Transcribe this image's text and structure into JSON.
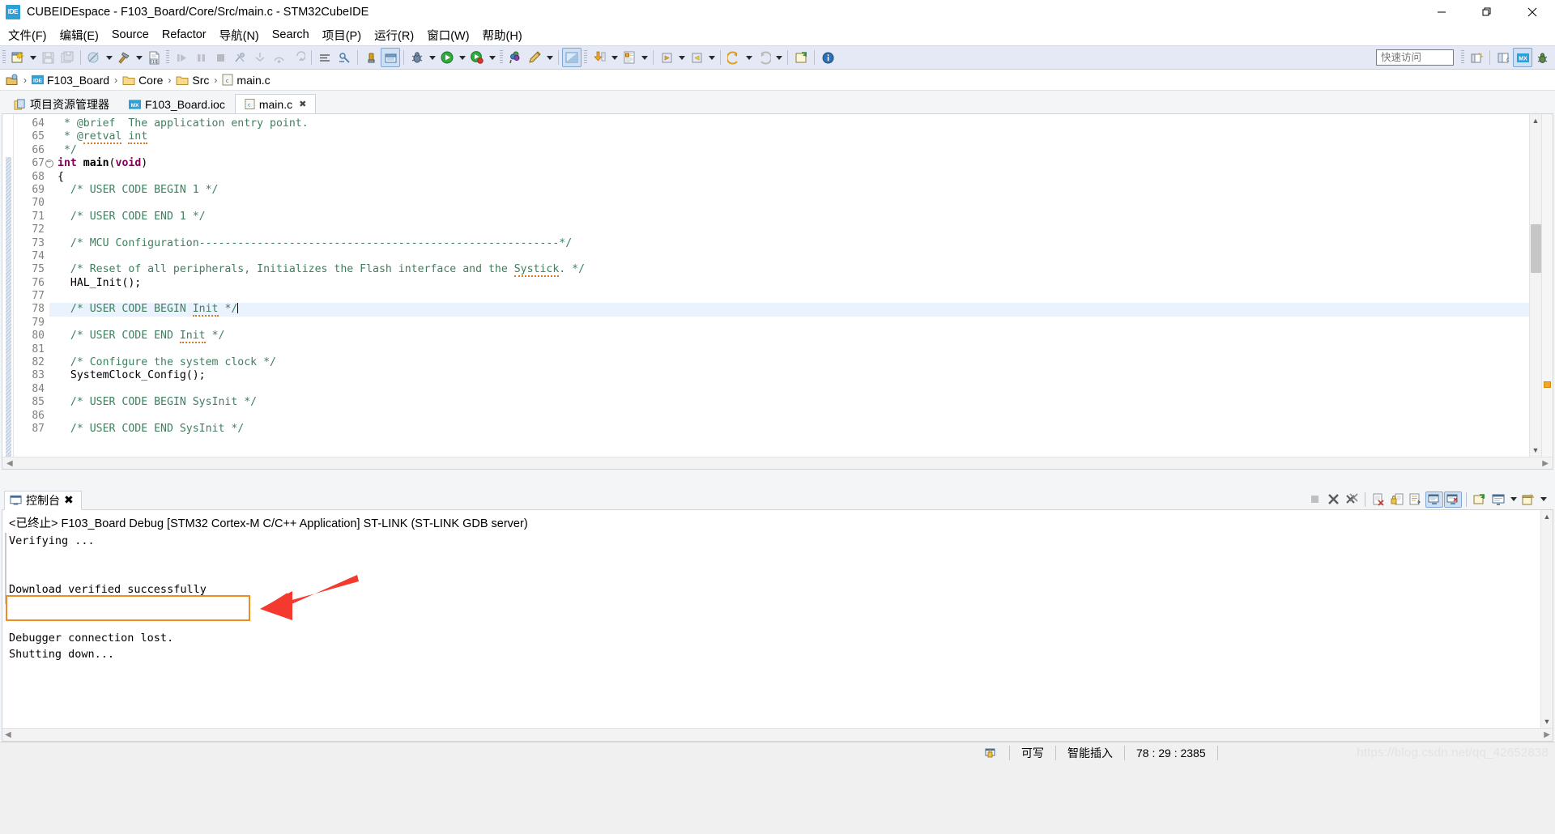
{
  "window": {
    "title": "CUBEIDEspace - F103_Board/Core/Src/main.c - STM32CubeIDE",
    "app_badge": "IDE",
    "minimize": "—",
    "maximize": "❐",
    "close": "✕"
  },
  "menubar": {
    "items": [
      {
        "label": "文件(F)",
        "name": "menu-file"
      },
      {
        "label": "编辑(E)",
        "name": "menu-edit"
      },
      {
        "label": "Source",
        "name": "menu-source"
      },
      {
        "label": "Refactor",
        "name": "menu-refactor"
      },
      {
        "label": "导航(N)",
        "name": "menu-navigate"
      },
      {
        "label": "Search",
        "name": "menu-search"
      },
      {
        "label": "项目(P)",
        "name": "menu-project"
      },
      {
        "label": "运行(R)",
        "name": "menu-run"
      },
      {
        "label": "窗口(W)",
        "name": "menu-window"
      },
      {
        "label": "帮助(H)",
        "name": "menu-help"
      }
    ]
  },
  "toolbar": {
    "quick_access_placeholder": "快速访问",
    "quick_access_value": "",
    "icons": [
      "new-file-icon",
      "save-icon",
      "save-all-icon",
      "build-disabled-icon",
      "build-hammer-icon",
      "new-c-file-icon",
      "resume-icon",
      "suspend-icon",
      "terminate-icon",
      "disconnect-icon",
      "step-into-icon",
      "step-over-icon",
      "step-return-icon",
      "skip-breakpoints-icon",
      "debug-config-icon",
      "run-icon",
      "debug-icon",
      "profile-icon",
      "external-tools-icon",
      "cube-mx-icon",
      "download-icon",
      "open-perspective-icon",
      "search-icon",
      "next-annotation-icon",
      "previous-annotation-icon",
      "last-edit-location-icon",
      "back-icon",
      "forward-icon",
      "pin-editor-icon",
      "info-icon"
    ],
    "right_icons": [
      "new-perspective-icon",
      "c-cpp-perspective-icon",
      "cubemx-perspective-icon",
      "debug-perspective-icon"
    ]
  },
  "breadcrumb": {
    "segments": [
      {
        "label": "",
        "icon": "workspace-icon",
        "name": "breadcrumb-workspace"
      },
      {
        "label": "F103_Board",
        "icon": "project-icon",
        "name": "breadcrumb-project"
      },
      {
        "label": "Core",
        "icon": "folder-icon",
        "name": "breadcrumb-core"
      },
      {
        "label": "Src",
        "icon": "folder-icon",
        "name": "breadcrumb-src"
      },
      {
        "label": "main.c",
        "icon": "c-file-icon",
        "name": "breadcrumb-file"
      }
    ],
    "separator": "›"
  },
  "editor": {
    "tabs": [
      {
        "label": "项目资源管理器",
        "icon": "project-explorer-icon",
        "active": false,
        "closable": false
      },
      {
        "label": "F103_Board.ioc",
        "icon": "cubemx-icon",
        "active": false,
        "closable": false
      },
      {
        "label": "main.c",
        "icon": "c-file-icon",
        "active": true,
        "closable": true
      }
    ],
    "close_glyph": "✖",
    "highlighted_line": 78,
    "lines": [
      {
        "num": 64,
        "fold": false,
        "changed": false,
        "tokens": [
          {
            "t": " * @brief  The application entry point.",
            "c": "comment"
          }
        ]
      },
      {
        "num": 65,
        "fold": false,
        "changed": false,
        "tokens": [
          {
            "t": " * @",
            "c": "comment"
          },
          {
            "t": "retval",
            "c": "comment-spell"
          },
          {
            "t": " ",
            "c": "comment"
          },
          {
            "t": "int",
            "c": "comment-spell"
          }
        ]
      },
      {
        "num": 66,
        "fold": false,
        "changed": false,
        "tokens": [
          {
            "t": " */",
            "c": "comment"
          }
        ]
      },
      {
        "num": 67,
        "fold": true,
        "changed": true,
        "tokens": [
          {
            "t": "int",
            "c": "kw"
          },
          {
            "t": " ",
            "c": "plain"
          },
          {
            "t": "main",
            "c": "bold"
          },
          {
            "t": "(",
            "c": "plain"
          },
          {
            "t": "void",
            "c": "kw"
          },
          {
            "t": ")",
            "c": "plain"
          }
        ]
      },
      {
        "num": 68,
        "fold": false,
        "changed": true,
        "tokens": [
          {
            "t": "{",
            "c": "plain"
          }
        ]
      },
      {
        "num": 69,
        "fold": false,
        "changed": true,
        "tokens": [
          {
            "t": "  /* USER CODE BEGIN 1 */",
            "c": "comment"
          }
        ]
      },
      {
        "num": 70,
        "fold": false,
        "changed": true,
        "tokens": [
          {
            "t": "",
            "c": "plain"
          }
        ]
      },
      {
        "num": 71,
        "fold": false,
        "changed": true,
        "tokens": [
          {
            "t": "  /* USER CODE END 1 */",
            "c": "comment"
          }
        ]
      },
      {
        "num": 72,
        "fold": false,
        "changed": true,
        "tokens": [
          {
            "t": "",
            "c": "plain"
          }
        ]
      },
      {
        "num": 73,
        "fold": false,
        "changed": true,
        "tokens": [
          {
            "t": "  /* MCU Configuration--------------------------------------------------------*/",
            "c": "comment"
          }
        ]
      },
      {
        "num": 74,
        "fold": false,
        "changed": true,
        "tokens": [
          {
            "t": "",
            "c": "plain"
          }
        ]
      },
      {
        "num": 75,
        "fold": false,
        "changed": true,
        "tokens": [
          {
            "t": "  /* Reset of all peripherals, Initializes the Flash interface and the ",
            "c": "comment"
          },
          {
            "t": "Systick",
            "c": "comment-spell"
          },
          {
            "t": ". */",
            "c": "comment"
          }
        ]
      },
      {
        "num": 76,
        "fold": false,
        "changed": true,
        "tokens": [
          {
            "t": "  HAL_Init();",
            "c": "plain"
          }
        ]
      },
      {
        "num": 77,
        "fold": false,
        "changed": true,
        "tokens": [
          {
            "t": "",
            "c": "plain"
          }
        ]
      },
      {
        "num": 78,
        "fold": false,
        "changed": true,
        "tokens": [
          {
            "t": "  /* USER CODE BEGIN ",
            "c": "comment"
          },
          {
            "t": "Init",
            "c": "comment-spell"
          },
          {
            "t": " */",
            "c": "comment"
          }
        ]
      },
      {
        "num": 79,
        "fold": false,
        "changed": true,
        "tokens": [
          {
            "t": "",
            "c": "plain"
          }
        ]
      },
      {
        "num": 80,
        "fold": false,
        "changed": true,
        "tokens": [
          {
            "t": "  /* USER CODE END ",
            "c": "comment"
          },
          {
            "t": "Init",
            "c": "comment-spell"
          },
          {
            "t": " */",
            "c": "comment"
          }
        ]
      },
      {
        "num": 81,
        "fold": false,
        "changed": true,
        "tokens": [
          {
            "t": "",
            "c": "plain"
          }
        ]
      },
      {
        "num": 82,
        "fold": false,
        "changed": true,
        "tokens": [
          {
            "t": "  /* Configure the system clock */",
            "c": "comment"
          }
        ]
      },
      {
        "num": 83,
        "fold": false,
        "changed": true,
        "tokens": [
          {
            "t": "  SystemClock_Config();",
            "c": "plain"
          }
        ]
      },
      {
        "num": 84,
        "fold": false,
        "changed": true,
        "tokens": [
          {
            "t": "",
            "c": "plain"
          }
        ]
      },
      {
        "num": 85,
        "fold": false,
        "changed": true,
        "tokens": [
          {
            "t": "  /* USER CODE BEGIN SysInit */",
            "c": "comment"
          }
        ]
      },
      {
        "num": 86,
        "fold": false,
        "changed": true,
        "tokens": [
          {
            "t": "",
            "c": "plain"
          }
        ]
      },
      {
        "num": 87,
        "fold": false,
        "changed": true,
        "tokens": [
          {
            "t": "  /* USER CODE END SysInit */",
            "c": "comment"
          }
        ]
      }
    ]
  },
  "console": {
    "tab_label": "控制台",
    "tab_icon": "console-icon",
    "close_glyph": "✖",
    "header": "<已终止> F103_Board Debug [STM32 Cortex-M C/C++ Application] ST-LINK (ST-LINK GDB server)",
    "output": [
      "Verifying ...",
      "",
      "",
      "Download verified successfully",
      "",
      "",
      "Debugger connection lost.",
      "Shutting down..."
    ],
    "highlight_text": "Download verified successfully",
    "highlight_color": "#ef8b20",
    "arrow_color": "#f4392f",
    "tools": [
      "terminate-icon",
      "remove-launch-icon",
      "remove-all-terminated-icon",
      "clear-console-icon",
      "scroll-lock-icon",
      "word-wrap-icon",
      "show-console-on-output-icon",
      "show-console-on-error-icon",
      "pin-console-icon",
      "display-selected-console-icon",
      "open-console-icon"
    ]
  },
  "statusbar": {
    "writable": "可写",
    "insert_mode": "智能插入",
    "position": "78 : 29 : 2385",
    "lock_icon": "editor-lock-icon",
    "watermark": "https://blog.csdn.net/qq_42652838"
  },
  "colors": {
    "accent": "#2f9fd8",
    "toolbar_bg": "#e4e9f5",
    "comment": "#3f7f5f",
    "keyword": "#7f0055",
    "highlight_line": "#eaf2fd"
  }
}
